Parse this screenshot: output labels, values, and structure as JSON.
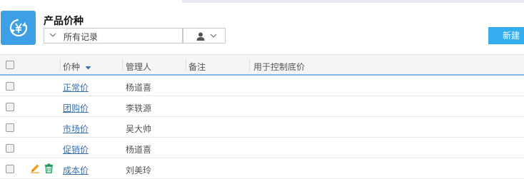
{
  "object_title": "产品价种",
  "view_selector": {
    "label": "所有记录"
  },
  "toolbar": {
    "new_label": "新建"
  },
  "columns": [
    {
      "label": "价种",
      "sortable": true
    },
    {
      "label": "管理人"
    },
    {
      "label": "备注"
    },
    {
      "label": "用于控制底价"
    }
  ],
  "rows": [
    {
      "name": "正常价",
      "manager": "杨道喜"
    },
    {
      "name": "团购价",
      "manager": "李轶源"
    },
    {
      "name": "市场价",
      "manager": "吴大帅"
    },
    {
      "name": "促销价",
      "manager": "杨道喜"
    },
    {
      "name": "成本价",
      "manager": "刘美玲"
    }
  ],
  "colors": {
    "accent": "#35aef0",
    "icon_bg": "#3da0e6",
    "link": "#3b6fa8"
  }
}
